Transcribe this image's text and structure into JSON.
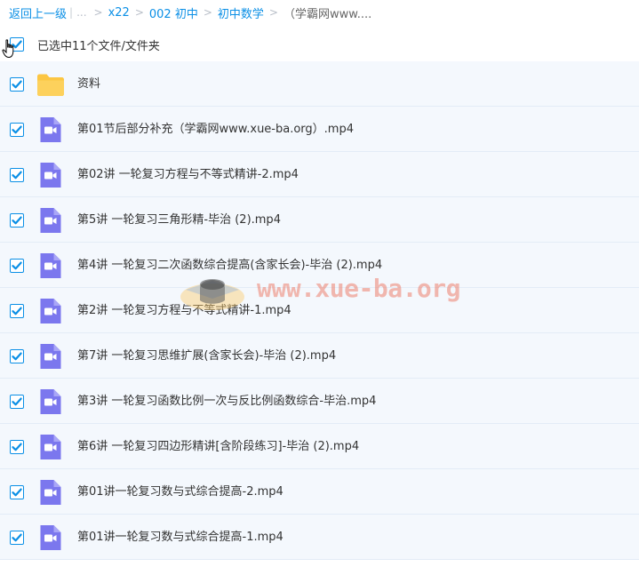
{
  "breadcrumb": {
    "back_label": "返回上一级",
    "ellipsis": "...",
    "items": [
      "x22",
      "002 初中",
      "初中数学"
    ],
    "current": "（学霸网www...."
  },
  "selection": {
    "label": "已选中11个文件/文件夹",
    "all_checked": true
  },
  "files": [
    {
      "name": "资料",
      "type": "folder",
      "checked": true
    },
    {
      "name": "第01节后部分补充（学霸网www.xue-ba.org）.mp4",
      "type": "video",
      "checked": true
    },
    {
      "name": "第02讲 一轮复习方程与不等式精讲-2.mp4",
      "type": "video",
      "checked": true
    },
    {
      "name": "第5讲 一轮复习三角形精-毕治 (2).mp4",
      "type": "video",
      "checked": true
    },
    {
      "name": "第4讲 一轮复习二次函数综合提高(含家长会)-毕治 (2).mp4",
      "type": "video",
      "checked": true
    },
    {
      "name": "第2讲 一轮复习方程与不等式精讲-1.mp4",
      "type": "video",
      "checked": true
    },
    {
      "name": "第7讲 一轮复习思维扩展(含家长会)-毕治 (2).mp4",
      "type": "video",
      "checked": true
    },
    {
      "name": "第3讲 一轮复习函数比例一次与反比例函数综合-毕治.mp4",
      "type": "video",
      "checked": true
    },
    {
      "name": "第6讲 一轮复习四边形精讲[含阶段练习]-毕治 (2).mp4",
      "type": "video",
      "checked": true
    },
    {
      "name": "第01讲一轮复习数与式综合提高-2.mp4",
      "type": "video",
      "checked": true
    },
    {
      "name": "第01讲一轮复习数与式综合提高-1.mp4",
      "type": "video",
      "checked": true
    }
  ],
  "watermark": {
    "text": "www.xue-ba.org"
  },
  "colors": {
    "accent": "#0a8fe6",
    "folder": "#fcc642",
    "video": "#7b77ee",
    "row_bg": "#f4f8fd"
  },
  "icons": {
    "checkbox": "checkmark-icon",
    "folder": "folder-icon",
    "video": "video-file-icon",
    "cursor": "hand-cursor-icon"
  }
}
